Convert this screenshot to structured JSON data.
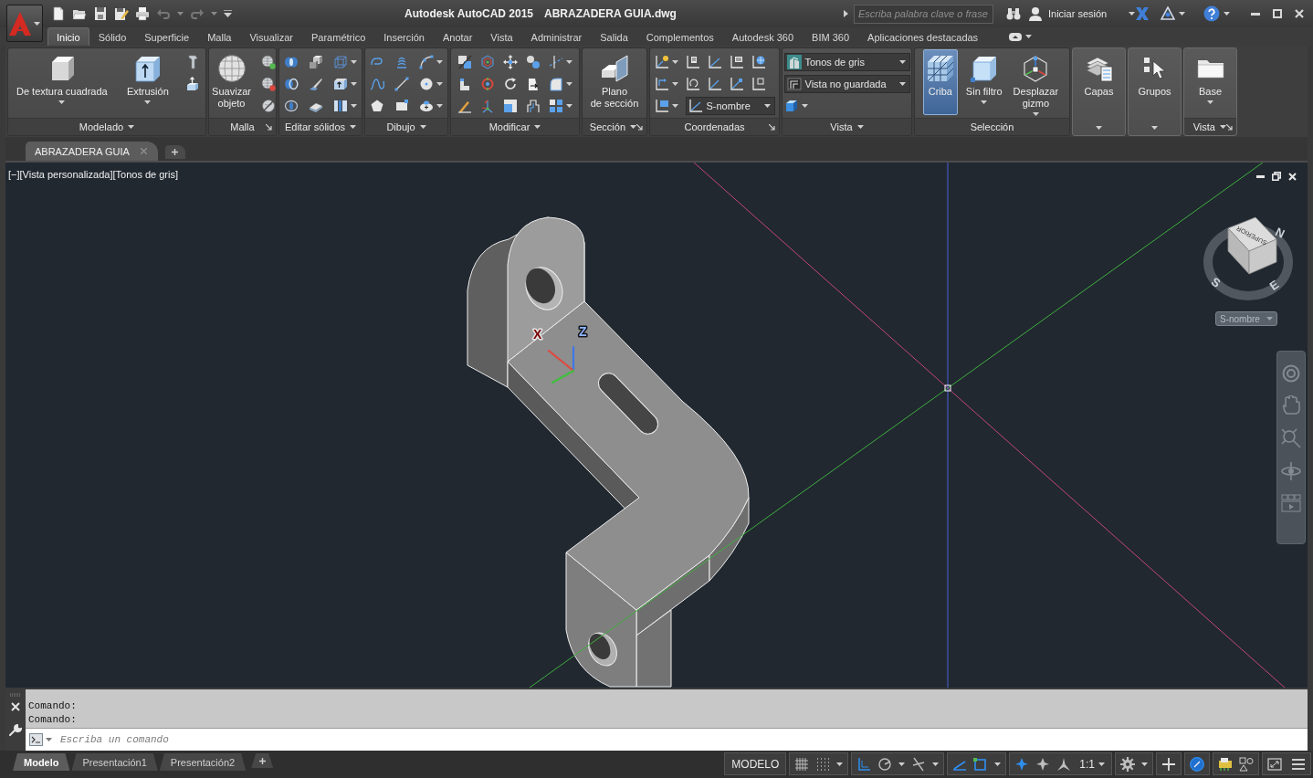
{
  "title_bar": {
    "product": "Autodesk AutoCAD 2015",
    "file": "ABRAZADERA GUIA.dwg",
    "search": {
      "placeholder": "Escriba palabra clave o frase"
    },
    "sign_in": "Iniciar sesión"
  },
  "ribbon_tabs": [
    {
      "label": "Inicio",
      "selected": true
    },
    {
      "label": "Sólido",
      "selected": false
    },
    {
      "label": "Superficie",
      "selected": false
    },
    {
      "label": "Malla",
      "selected": false
    },
    {
      "label": "Visualizar",
      "selected": false
    },
    {
      "label": "Paramétrico",
      "selected": false
    },
    {
      "label": "Inserción",
      "selected": false
    },
    {
      "label": "Anotar",
      "selected": false
    },
    {
      "label": "Vista",
      "selected": false
    },
    {
      "label": "Administrar",
      "selected": false
    },
    {
      "label": "Salida",
      "selected": false
    },
    {
      "label": "Complementos",
      "selected": false
    },
    {
      "label": "Autodesk 360",
      "selected": false
    },
    {
      "label": "BIM 360",
      "selected": false
    },
    {
      "label": "Aplicaciones destacadas",
      "selected": false
    }
  ],
  "ribbon_panels": [
    {
      "kind": "tools",
      "title": "Modelado",
      "menu": true,
      "launcher": false,
      "large_buttons": [
        {
          "label": "De textura cuadrada",
          "dropdown": true,
          "on": false
        },
        {
          "label": "Extrusión",
          "dropdown": true,
          "on": false
        }
      ]
    },
    {
      "kind": "tools",
      "title": "Malla",
      "menu": false,
      "launcher": true,
      "large_buttons": [
        {
          "label": "Suavizar\nobjeto",
          "dropdown": false,
          "on": false
        }
      ]
    },
    {
      "kind": "tools",
      "title": "Editar sólidos",
      "menu": true,
      "launcher": false
    },
    {
      "kind": "tools",
      "title": "Dibujo",
      "menu": true,
      "launcher": false
    },
    {
      "kind": "tools",
      "title": "Modificar",
      "menu": true,
      "launcher": false
    },
    {
      "kind": "tools",
      "title": "Sección",
      "menu": true,
      "launcher": true,
      "large_buttons": [
        {
          "label": "Plano\nde sección",
          "dropdown": false,
          "on": false
        }
      ]
    },
    {
      "kind": "tools",
      "title": "Coordenadas",
      "menu": false,
      "launcher": true,
      "combos": [
        {
          "value": "S-nombre"
        }
      ]
    },
    {
      "kind": "tools",
      "title": "Vista",
      "menu": true,
      "launcher": false,
      "combos": [
        {
          "value": "Tonos de gris"
        },
        {
          "value": "Vista no guardada"
        }
      ]
    },
    {
      "kind": "tools",
      "title": "Selección",
      "menu": false,
      "launcher": false,
      "large_buttons": [
        {
          "label": "Criba",
          "dropdown": false,
          "on": true
        },
        {
          "label": "Sin filtro",
          "dropdown": true,
          "on": false
        },
        {
          "label": "Desplazar\ngizmo",
          "dropdown": true,
          "on": false
        }
      ]
    },
    {
      "kind": "collapsed",
      "label": "Capas"
    },
    {
      "kind": "collapsed",
      "label": "Grupos"
    },
    {
      "kind": "tools",
      "title": "Vista",
      "menu": true,
      "launcher": true,
      "large_buttons": [
        {
          "label": "Base",
          "dropdown": true,
          "on": false
        }
      ]
    }
  ],
  "document_tabs": [
    {
      "label": "ABRAZADERA GUIA",
      "selected": true
    }
  ],
  "viewport": {
    "controls": [
      "[−]",
      "[Vista personalizada]",
      "[Tonos de gris]"
    ],
    "view_cube": {
      "face_label": "SUPERIOR",
      "compass": [
        "N",
        "E",
        "S"
      ]
    },
    "ucs_menu": "S-nombre",
    "ucs_axes": [
      "X",
      "Z"
    ]
  },
  "command_line": {
    "history": [
      "Comando:",
      "Comando:"
    ],
    "placeholder": "Escriba un comando"
  },
  "layout_tabs": [
    {
      "label": "Modelo",
      "selected": true
    },
    {
      "label": "Presentación1",
      "selected": false
    },
    {
      "label": "Presentación2",
      "selected": false
    }
  ],
  "status_bar": {
    "space": "MODELO",
    "toggles": [
      {
        "on": false
      },
      {
        "on": false
      },
      {
        "on": true
      },
      {
        "on": false
      },
      {
        "on": false
      },
      {
        "on": true
      },
      {
        "on": true
      },
      {
        "on": true
      },
      {
        "on": false
      },
      {
        "on": true
      }
    ],
    "scale": "1:1"
  }
}
